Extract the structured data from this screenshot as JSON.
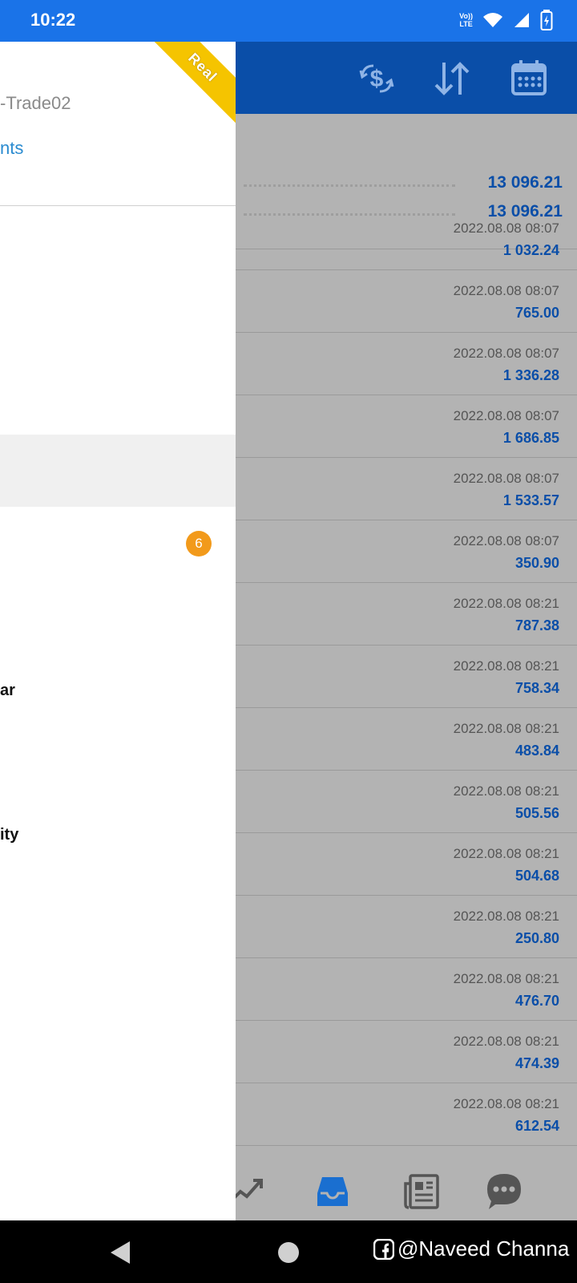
{
  "status_bar": {
    "time": "10:22",
    "volte_top": "Vo))",
    "volte_bottom": "LTE",
    "icons": [
      "volte-icon",
      "wifi-icon",
      "signal-icon",
      "battery-icon"
    ]
  },
  "drawer": {
    "ribbon": "Real",
    "account_server": "-Trade02",
    "accounts_link": "nts",
    "badge": "6",
    "items": [
      {
        "label": "ar",
        "top": 0
      },
      {
        "label": "ity",
        "top": 0
      }
    ]
  },
  "toolbar": {
    "icons": [
      "currency-exchange-icon",
      "sort-icon",
      "calendar-icon"
    ]
  },
  "summary": {
    "values": [
      "13 096.21",
      "13 096.21"
    ]
  },
  "history": [
    {
      "time": "2022.08.08 08:07",
      "amount": "1 032.24"
    },
    {
      "time": "2022.08.08 08:07",
      "amount": "765.00"
    },
    {
      "time": "2022.08.08 08:07",
      "amount": "1 336.28"
    },
    {
      "time": "2022.08.08 08:07",
      "amount": "1 686.85"
    },
    {
      "time": "2022.08.08 08:07",
      "amount": "1 533.57"
    },
    {
      "time": "2022.08.08 08:07",
      "amount": "350.90"
    },
    {
      "time": "2022.08.08 08:21",
      "amount": "787.38"
    },
    {
      "time": "2022.08.08 08:21",
      "amount": "758.34"
    },
    {
      "time": "2022.08.08 08:21",
      "amount": "483.84"
    },
    {
      "time": "2022.08.08 08:21",
      "amount": "505.56"
    },
    {
      "time": "2022.08.08 08:21",
      "amount": "504.68"
    },
    {
      "time": "2022.08.08 08:21",
      "amount": "250.80"
    },
    {
      "time": "2022.08.08 08:21",
      "amount": "476.70"
    },
    {
      "time": "2022.08.08 08:21",
      "amount": "474.39"
    },
    {
      "time": "2022.08.08 08:21",
      "amount": "612.54"
    }
  ],
  "bottom_nav": {
    "icons": [
      "trade-chart-icon",
      "history-inbox-icon",
      "news-icon",
      "chat-icon"
    ],
    "active_color": "#1a6fd0",
    "inactive_color": "#555555"
  },
  "system_nav": {
    "watermark": "@Naveed Channa"
  }
}
